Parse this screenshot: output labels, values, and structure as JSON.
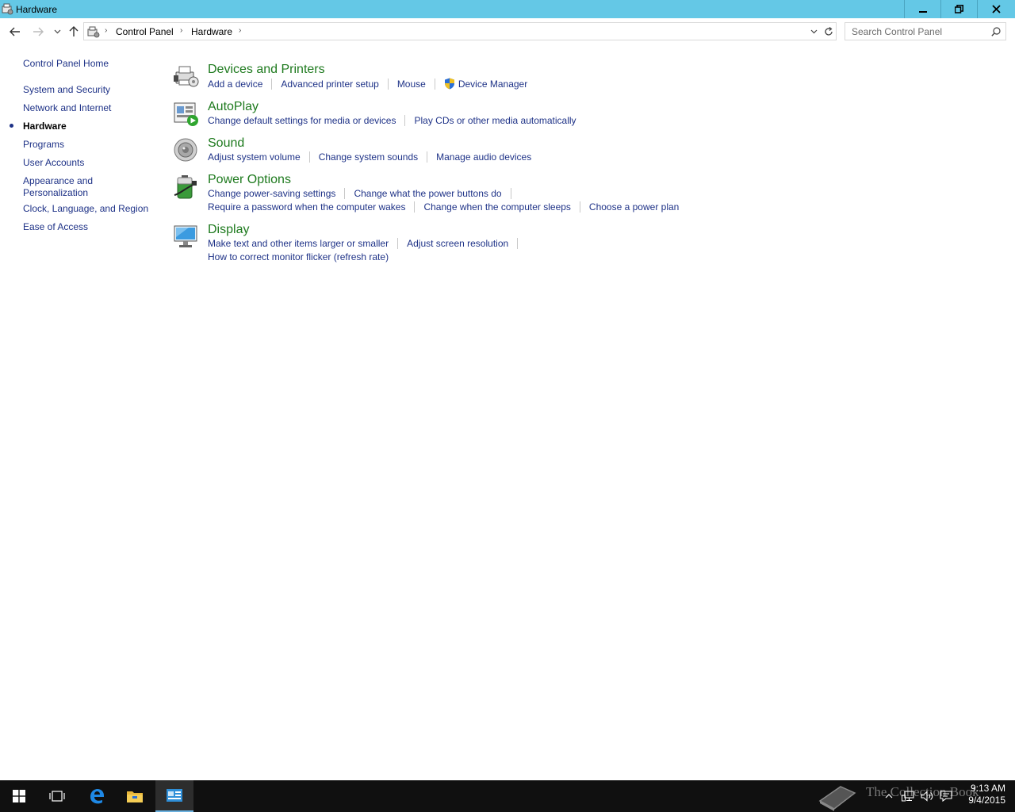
{
  "window": {
    "title": "Hardware",
    "buttons": {
      "minimize": "minimize",
      "maximize": "restore",
      "close": "close"
    }
  },
  "address": {
    "crumbs": [
      "Control Panel",
      "Hardware"
    ],
    "search_placeholder": "Search Control Panel"
  },
  "sidebar": {
    "items": [
      {
        "label": "Control Panel Home"
      },
      {
        "label": "System and Security"
      },
      {
        "label": "Network and Internet"
      },
      {
        "label": "Hardware",
        "current": true
      },
      {
        "label": "Programs"
      },
      {
        "label": "User Accounts"
      },
      {
        "label": "Appearance and Personalization"
      },
      {
        "label": "Clock, Language, and Region"
      },
      {
        "label": "Ease of Access"
      }
    ],
    "appearance_line1": "Appearance and",
    "appearance_line2": "Personalization"
  },
  "categories": [
    {
      "title": "Devices and Printers",
      "icon": "printer-icon",
      "rows": [
        [
          "Add a device",
          "Advanced printer setup",
          "Mouse",
          "Device Manager"
        ]
      ]
    },
    {
      "title": "AutoPlay",
      "icon": "autoplay-icon",
      "rows": [
        [
          "Change default settings for media or devices",
          "Play CDs or other media automatically"
        ]
      ]
    },
    {
      "title": "Sound",
      "icon": "speaker-icon",
      "rows": [
        [
          "Adjust system volume",
          "Change system sounds",
          "Manage audio devices"
        ]
      ]
    },
    {
      "title": "Power Options",
      "icon": "battery-icon",
      "rows": [
        [
          "Change power-saving settings",
          "Change what the power buttons do"
        ],
        [
          "Require a password when the computer wakes",
          "Change when the computer sleeps",
          "Choose a power plan"
        ]
      ]
    },
    {
      "title": "Display",
      "icon": "monitor-icon",
      "rows": [
        [
          "Make text and other items larger or smaller",
          "Adjust screen resolution"
        ],
        [
          "How to correct monitor flicker (refresh rate)"
        ]
      ]
    }
  ],
  "taskbar": {
    "watermark": "The Collection Book",
    "time": "9:13 AM",
    "date": "9/4/2015"
  },
  "colors": {
    "titlebar": "#64c8e6",
    "link": "#1e3287",
    "category_title": "#1e7a1e",
    "taskbar": "#101010"
  }
}
